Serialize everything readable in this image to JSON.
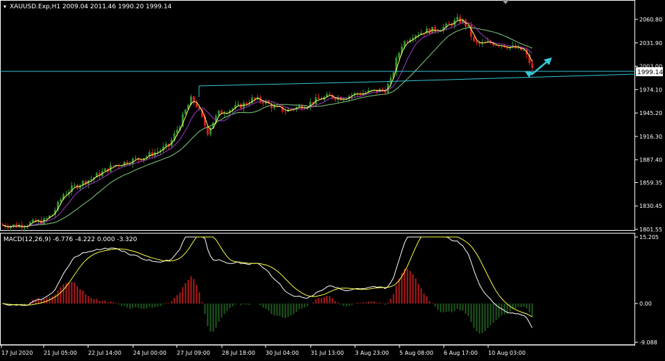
{
  "main_chart": {
    "header": "XAUUSD.Exp,H1  2009.04 2011.46 1990.20 1999.14",
    "price_axis": [
      "2060.80",
      "2031.90",
      "2003.00",
      "1974.10",
      "1945.20",
      "1916.30",
      "1887.40",
      "1859.35",
      "1830.45",
      "1801.55"
    ],
    "current_price": "1999.14"
  },
  "macd": {
    "header": "MACD(12,26,9) -6.776 -4.222 0.000 -3.320",
    "axis": [
      "15.205",
      "0.00",
      "-9.088"
    ]
  },
  "time_axis": [
    "17 Jul 2020",
    "21 Jul 05:00",
    "22 Jul 14:00",
    "24 Jul 00:00",
    "27 Jul 09:00",
    "28 Jul 18:00",
    "30 Jul 04:00",
    "31 Jul 13:00",
    "3 Aug 23:00",
    "5 Aug 08:00",
    "6 Aug 17:00",
    "10 Aug 03:00"
  ],
  "colors": {
    "bull": "#2e8b2e",
    "bear": "#d41a1a",
    "ma_fast": "#ffff66",
    "ma_mid": "#a03cc8",
    "ma_slow": "#7fd17f",
    "trendline": "#37c8d8",
    "macd_line": "#ffffff",
    "signal_line": "#ffff44",
    "hist_pos": "#b51c1c",
    "hist_neg": "#1e5a1e"
  },
  "chart_data": {
    "type": "candlestick",
    "symbol": "XAUUSD.Exp",
    "timeframe": "H1",
    "price_range": [
      1801.55,
      2060.8
    ],
    "close_path": [
      [
        0,
        1807
      ],
      [
        5,
        1806
      ],
      [
        10,
        1809
      ],
      [
        15,
        1812
      ],
      [
        18,
        1820
      ],
      [
        20,
        1832
      ],
      [
        22,
        1845
      ],
      [
        25,
        1852
      ],
      [
        28,
        1858
      ],
      [
        32,
        1864
      ],
      [
        36,
        1872
      ],
      [
        40,
        1880
      ],
      [
        44,
        1884
      ],
      [
        48,
        1888
      ],
      [
        52,
        1892
      ],
      [
        56,
        1898
      ],
      [
        60,
        1905
      ],
      [
        62,
        1918
      ],
      [
        64,
        1932
      ],
      [
        66,
        1948
      ],
      [
        68,
        1962
      ],
      [
        70,
        1955
      ],
      [
        72,
        1938
      ],
      [
        74,
        1922
      ],
      [
        76,
        1935
      ],
      [
        78,
        1945
      ],
      [
        82,
        1950
      ],
      [
        86,
        1954
      ],
      [
        90,
        1962
      ],
      [
        94,
        1960
      ],
      [
        98,
        1952
      ],
      [
        102,
        1948
      ],
      [
        106,
        1952
      ],
      [
        110,
        1956
      ],
      [
        114,
        1962
      ],
      [
        118,
        1966
      ],
      [
        122,
        1964
      ],
      [
        126,
        1968
      ],
      [
        130,
        1970
      ],
      [
        134,
        1972
      ],
      [
        138,
        1974
      ],
      [
        140,
        1985
      ],
      [
        142,
        2010
      ],
      [
        144,
        2030
      ],
      [
        146,
        2036
      ],
      [
        148,
        2042
      ],
      [
        152,
        2046
      ],
      [
        156,
        2048
      ],
      [
        160,
        2052
      ],
      [
        164,
        2060
      ],
      [
        166,
        2058
      ],
      [
        168,
        2050
      ],
      [
        170,
        2032
      ],
      [
        172,
        2030
      ],
      [
        176,
        2032
      ],
      [
        180,
        2030
      ],
      [
        184,
        2026
      ],
      [
        188,
        2022
      ],
      [
        190,
        2008
      ],
      [
        191,
        1999
      ]
    ]
  }
}
